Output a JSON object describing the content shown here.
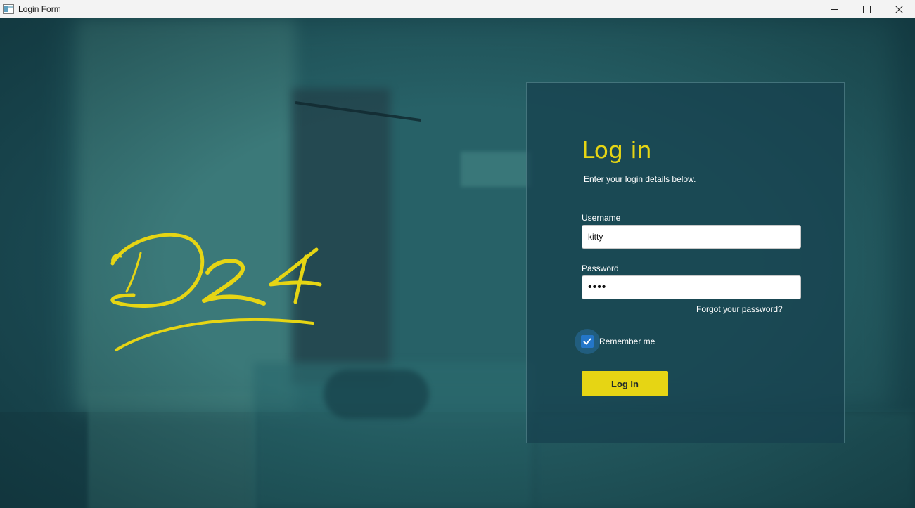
{
  "window": {
    "title": "Login Form",
    "controls": {
      "minimize_icon": "minimize-icon",
      "maximize_icon": "maximize-icon",
      "close_icon": "close-icon"
    }
  },
  "logo": {
    "text": "D24",
    "color": "#e6d514"
  },
  "login": {
    "title": "Log in",
    "subtitle": "Enter your login details below.",
    "username_label": "Username",
    "username_value": "kitty",
    "password_label": "Password",
    "password_value": "••••",
    "forgot_link": "Forgot your password?",
    "remember_label": "Remember me",
    "remember_checked": true,
    "submit_label": "Log In"
  },
  "colors": {
    "accent": "#e6d514",
    "background": "#1c4f58",
    "card": "#16404e",
    "checkbox": "#2476c8"
  }
}
